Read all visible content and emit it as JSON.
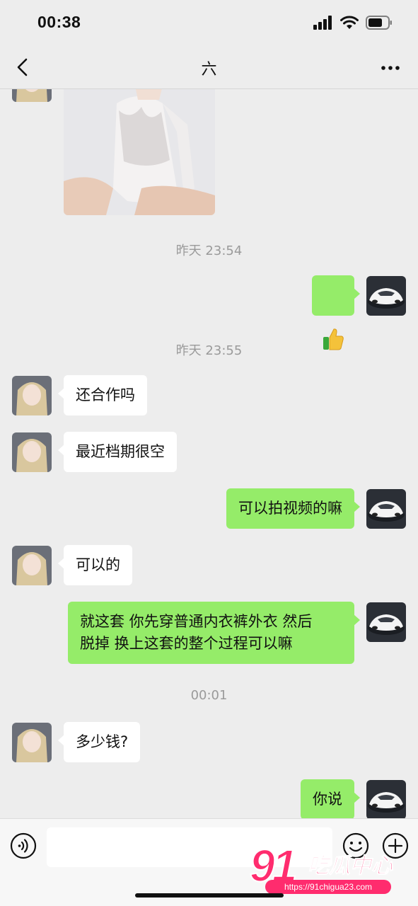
{
  "status_bar": {
    "time": "00:38",
    "icons": [
      "signal-icon",
      "wifi-icon",
      "battery-icon"
    ]
  },
  "nav": {
    "title": "六",
    "back_icon": "chevron-left-icon",
    "more_icon": "more-dots-icon"
  },
  "messages": [
    {
      "type": "image",
      "side": "in",
      "description": "photo"
    },
    {
      "type": "timestamp",
      "text": "昨天 23:54"
    },
    {
      "type": "text",
      "side": "out",
      "text": "👍"
    },
    {
      "type": "timestamp",
      "text": "昨天 23:55"
    },
    {
      "type": "text",
      "side": "in",
      "text": "还合作吗"
    },
    {
      "type": "text",
      "side": "in",
      "text": "最近档期很空"
    },
    {
      "type": "text",
      "side": "out",
      "text": "可以拍视频的嘛"
    },
    {
      "type": "text",
      "side": "in",
      "text": "可以的"
    },
    {
      "type": "text",
      "side": "out",
      "text": "就这套 你先穿普通内衣裤外衣 然后\n脱掉 换上这套的整个过程可以嘛"
    },
    {
      "type": "timestamp",
      "text": "00:01"
    },
    {
      "type": "text",
      "side": "in",
      "text": "多少钱?"
    },
    {
      "type": "text",
      "side": "out",
      "text": "你说"
    }
  ],
  "input_bar": {
    "placeholder": "",
    "value": ""
  },
  "watermark": {
    "number": "91",
    "name": "吃瓜中心",
    "url": "https://91chigua23.com"
  },
  "colors": {
    "outgoing_bubble": "#95ec69",
    "incoming_bubble": "#ffffff",
    "background": "#ededed",
    "watermark": "#ff2c6e"
  }
}
